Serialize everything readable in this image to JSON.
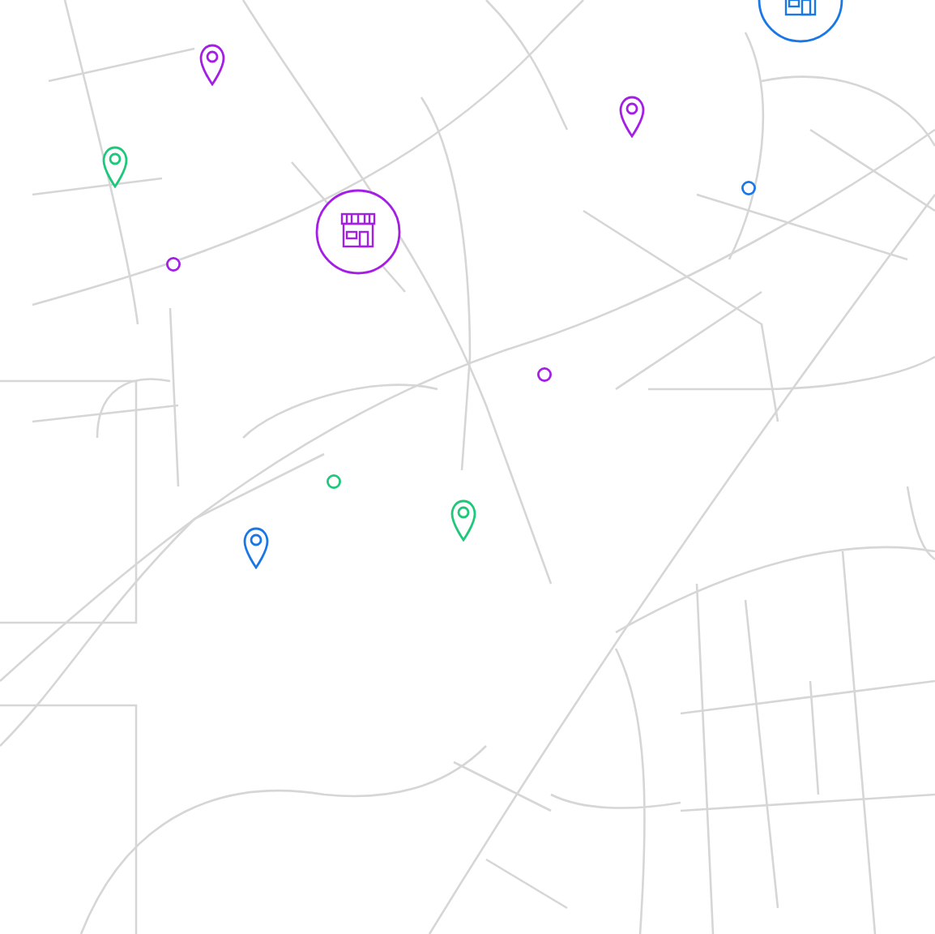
{
  "map": {
    "markers": [
      {
        "kind": "pin",
        "color": "#a41ee6"
      },
      {
        "kind": "pin",
        "color": "#a41ee6"
      },
      {
        "kind": "pin",
        "color": "#1ec87a"
      },
      {
        "kind": "pin",
        "color": "#1a78e6"
      },
      {
        "kind": "pin",
        "color": "#1ec87a"
      },
      {
        "kind": "dot",
        "color": "#a41ee6"
      },
      {
        "kind": "dot",
        "color": "#a41ee6"
      },
      {
        "kind": "dot",
        "color": "#1ec87a"
      },
      {
        "kind": "dot",
        "color": "#1a78e6"
      },
      {
        "kind": "store",
        "color": "#a41ee6"
      },
      {
        "kind": "store",
        "color": "#1a78e6"
      }
    ]
  }
}
